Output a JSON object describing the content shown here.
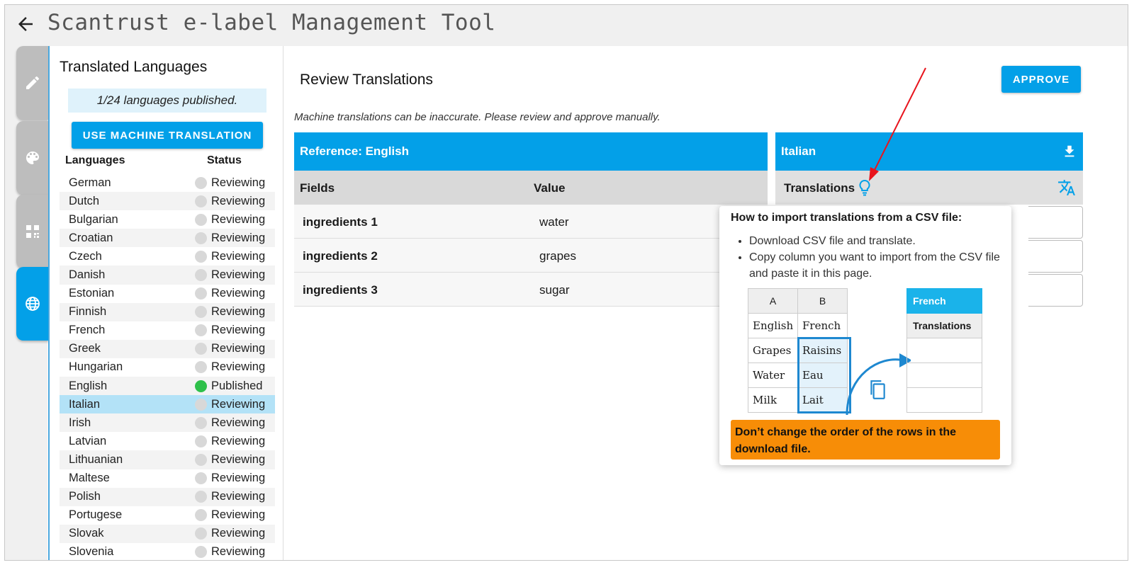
{
  "app": {
    "title": "Scantrust e-label Management Tool"
  },
  "rail": {
    "icons": [
      "pencil-icon",
      "palette-icon",
      "qr-code-icon",
      "globe-icon"
    ],
    "active": "globe-icon",
    "accent": "#03a0e8"
  },
  "sidebar": {
    "title": "Translated Languages",
    "banner": "1/24 languages published.",
    "mt_button": "USE MACHINE TRANSLATION",
    "col_languages": "Languages",
    "col_status": "Status",
    "languages": [
      {
        "name": "German",
        "status": "Reviewing"
      },
      {
        "name": "Dutch",
        "status": "Reviewing"
      },
      {
        "name": "Bulgarian",
        "status": "Reviewing"
      },
      {
        "name": "Croatian",
        "status": "Reviewing"
      },
      {
        "name": "Czech",
        "status": "Reviewing"
      },
      {
        "name": "Danish",
        "status": "Reviewing"
      },
      {
        "name": "Estonian",
        "status": "Reviewing"
      },
      {
        "name": "Finnish",
        "status": "Reviewing"
      },
      {
        "name": "French",
        "status": "Reviewing"
      },
      {
        "name": "Greek",
        "status": "Reviewing"
      },
      {
        "name": "Hungarian",
        "status": "Reviewing"
      },
      {
        "name": "English",
        "status": "Published"
      },
      {
        "name": "Italian",
        "status": "Reviewing"
      },
      {
        "name": "Irish",
        "status": "Reviewing"
      },
      {
        "name": "Latvian",
        "status": "Reviewing"
      },
      {
        "name": "Lithuanian",
        "status": "Reviewing"
      },
      {
        "name": "Maltese",
        "status": "Reviewing"
      },
      {
        "name": "Polish",
        "status": "Reviewing"
      },
      {
        "name": "Portugese",
        "status": "Reviewing"
      },
      {
        "name": "Slovak",
        "status": "Reviewing"
      },
      {
        "name": "Slovenia",
        "status": "Reviewing"
      }
    ],
    "selected": "Italian"
  },
  "main": {
    "title": "Review Translations",
    "approve": "APPROVE",
    "note": "Machine translations can be inaccurate. Please review and approve manually.",
    "reference": {
      "header": "Reference: English",
      "col_fields": "Fields",
      "col_value": "Value",
      "rows": [
        {
          "field": "ingredients 1",
          "value": "water"
        },
        {
          "field": "ingredients 2",
          "value": "grapes"
        },
        {
          "field": "ingredients 3",
          "value": "sugar"
        }
      ]
    },
    "target": {
      "header": "Italian",
      "sub": "Translations"
    }
  },
  "popup": {
    "title": "How to import translations from a CSV file:",
    "bullets": [
      "Download CSV file and translate.",
      "Copy column you want to import from the CSV file and paste it in this page."
    ],
    "csv": {
      "headers": [
        "A",
        "B"
      ],
      "rows": [
        [
          "English",
          "French"
        ],
        [
          "Grapes",
          "Raisins"
        ],
        [
          "Water",
          "Eau"
        ],
        [
          "Milk",
          "Lait"
        ]
      ]
    },
    "target_header": "French",
    "target_sub": "Translations",
    "warning": "Don’t change the order of the rows in the download file."
  }
}
